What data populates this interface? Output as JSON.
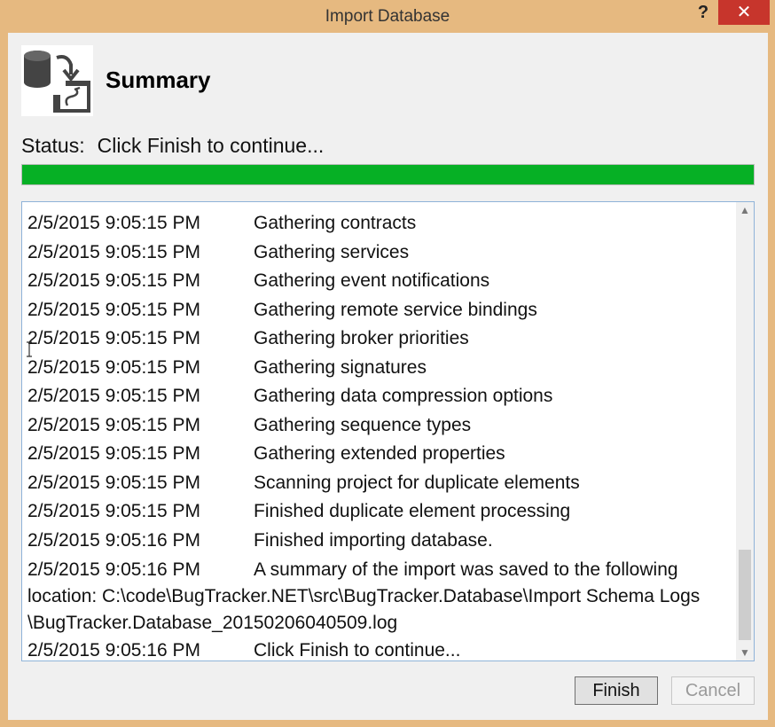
{
  "window": {
    "title": "Import Database",
    "help_label": "?",
    "close_label": "✕"
  },
  "header": {
    "title": "Summary",
    "icon": "database-import-icon"
  },
  "status": {
    "label": "Status:",
    "text": "Click Finish to continue..."
  },
  "progress": {
    "percent": 100,
    "color": "#06b025"
  },
  "log": {
    "rows": [
      {
        "time": "2/5/2015 9:05:15 PM",
        "message": "Gathering contracts"
      },
      {
        "time": "2/5/2015 9:05:15 PM",
        "message": "Gathering services"
      },
      {
        "time": "2/5/2015 9:05:15 PM",
        "message": "Gathering event notifications"
      },
      {
        "time": "2/5/2015 9:05:15 PM",
        "message": "Gathering remote service bindings"
      },
      {
        "time": "2/5/2015 9:05:15 PM",
        "message": "Gathering broker priorities"
      },
      {
        "time": "2/5/2015 9:05:15 PM",
        "message": "Gathering signatures"
      },
      {
        "time": "2/5/2015 9:05:15 PM",
        "message": "Gathering data compression options"
      },
      {
        "time": "2/5/2015 9:05:15 PM",
        "message": "Gathering sequence types"
      },
      {
        "time": "2/5/2015 9:05:15 PM",
        "message": "Gathering extended properties"
      },
      {
        "time": "2/5/2015 9:05:15 PM",
        "message": "Scanning project for duplicate elements"
      },
      {
        "time": "2/5/2015 9:05:15 PM",
        "message": "Finished duplicate element processing"
      },
      {
        "time": "2/5/2015 9:05:16 PM",
        "message": "Finished importing database."
      }
    ],
    "wrapped_entry": {
      "time": "2/5/2015 9:05:16 PM",
      "message": "A summary of the import was saved to the following",
      "line2": "location: C:\\code\\BugTracker.NET\\src\\BugTracker.Database\\Import Schema Logs",
      "line3": "\\BugTracker.Database_20150206040509.log"
    },
    "last_entry": {
      "time": "2/5/2015 9:05:16 PM",
      "message": "Click Finish to continue..."
    }
  },
  "buttons": {
    "finish": "Finish",
    "cancel": "Cancel"
  }
}
